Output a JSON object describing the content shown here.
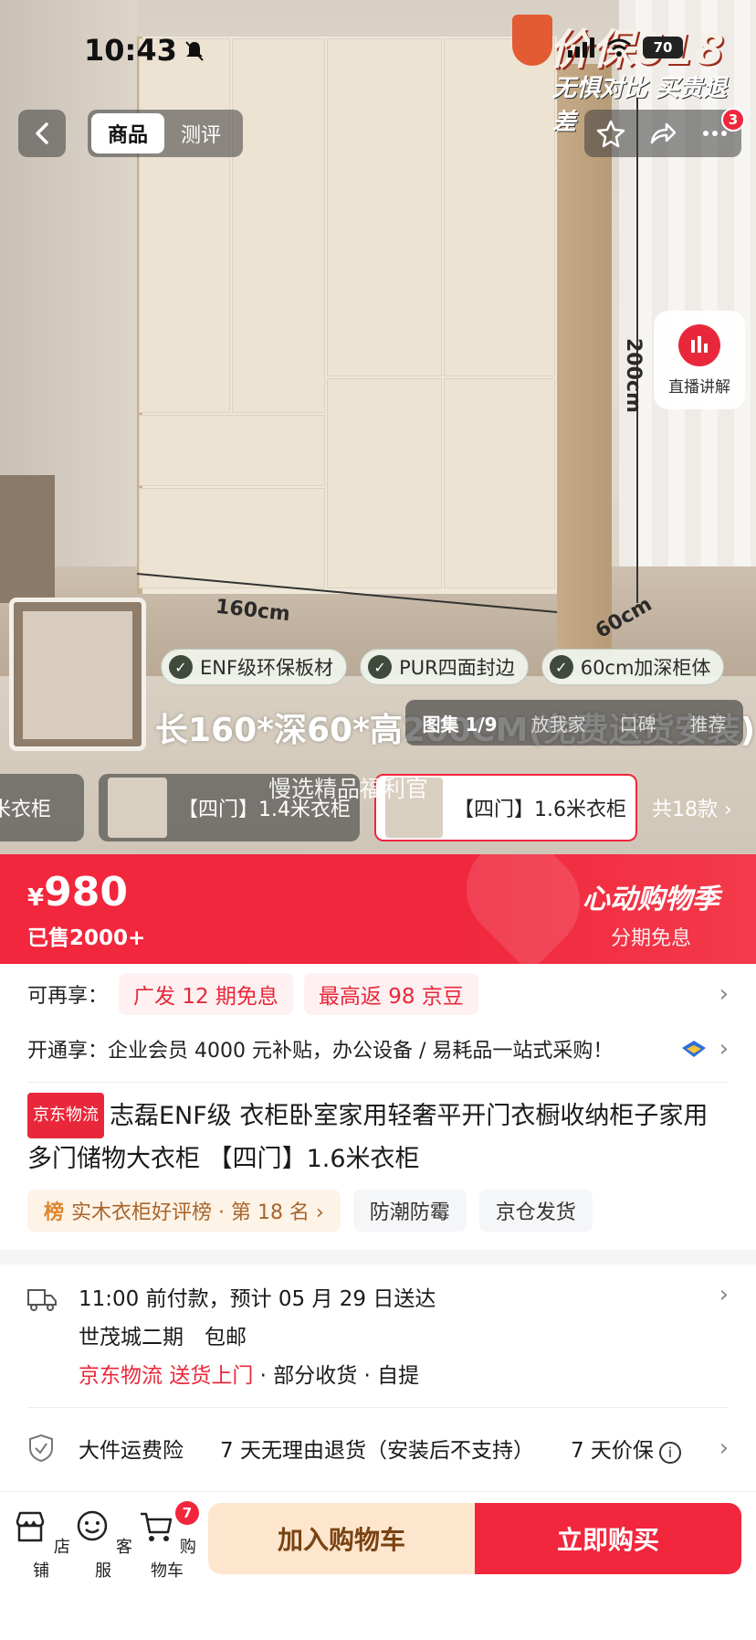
{
  "status": {
    "time": "10:43",
    "battery": "70"
  },
  "promo": {
    "big": "价保618",
    "small": "无惧对比 买贵退差"
  },
  "topnav": {
    "tab_goods": "商品",
    "tab_review": "测评",
    "notif_count": "3"
  },
  "live": {
    "label": "直播讲解"
  },
  "dims": {
    "width": "160cm",
    "depth": "60cm",
    "height": "200cm"
  },
  "features": [
    {
      "label": "ENF级环保板材"
    },
    {
      "label": "PUR四面封边"
    },
    {
      "label": "60cm加深柜体"
    }
  ],
  "banner": {
    "text": "长160*深60*高200CM(免费送货安装)"
  },
  "image_tabs": {
    "gallery": "图集 1/9",
    "home": "放我家",
    "reputation": "口碑",
    "recommend": "推荐"
  },
  "variants": {
    "items": [
      {
        "label": "米衣柜"
      },
      {
        "label": "【四门】1.4米衣柜"
      },
      {
        "label": "【四门】1.6米衣柜"
      }
    ],
    "count": "共18款",
    "hint": "慢选精品福利官"
  },
  "price": {
    "symbol": "¥",
    "value": "980",
    "sold": "已售2000+"
  },
  "event": {
    "title": "心动购物季",
    "sub": "分期免息"
  },
  "benefits": {
    "label": "可再享：",
    "pill1": "广发 12 期免息",
    "pill2": "最高返 98 京豆",
    "enterprise": "开通享：企业会员 4000 元补贴，办公设备 / 易耗品一站式采购！"
  },
  "title": {
    "badge": "京东物流",
    "text": "志磊ENF级 衣柜卧室家用轻奢平开门衣橱收纳柜子家用多门储物大衣柜 【四门】1.6米衣柜"
  },
  "tags": {
    "rank_icon": "榜",
    "rank": "实木衣柜好评榜 · 第 18 名 ›",
    "t1": "防潮防霉",
    "t2": "京仓发货"
  },
  "delivery": {
    "line1": "11:00 前付款，预计 05 月 29 日送达",
    "line2": "世茂城二期　包邮",
    "red1": "京东物流",
    "red2": "送货上门",
    "rest": " · 部分收货 · 自提"
  },
  "service": {
    "s1": "大件运费险",
    "s2": "7 天无理由退货（安装后不支持）",
    "s3": "7 天价保"
  },
  "bottom": {
    "store": "店铺",
    "service": "客服",
    "cart": "购物车",
    "cart_count": "7",
    "add_cart": "加入购物车",
    "buy_now": "立即购买"
  },
  "colors": {
    "accent": "#f2263d",
    "add_cart_bg": "#fde6cd"
  }
}
